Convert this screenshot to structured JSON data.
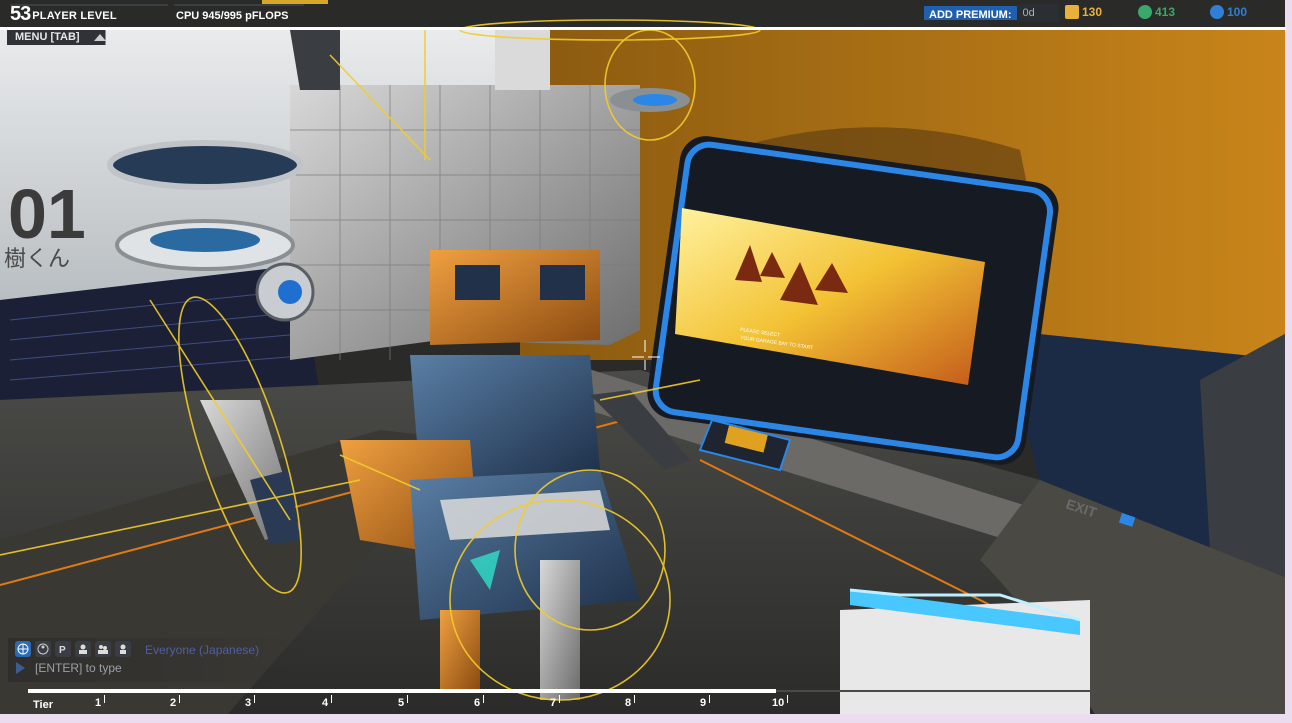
{
  "hud": {
    "player_level": "53",
    "player_level_label": "PLAYER LEVEL",
    "cpu_text": "CPU  945/995 pFLOPS",
    "menu_label": "MENU [TAB]",
    "premium_button": "ADD PREMIUM:",
    "premium_days": "0d",
    "currencies": [
      {
        "icon": "robits-icon",
        "value": "130",
        "color": "#e8b23a"
      },
      {
        "icon": "rp-icon",
        "value": "413",
        "color": "#3aa86a"
      },
      {
        "icon": "gc-icon",
        "value": "100",
        "color": "#2f7fd6"
      }
    ]
  },
  "chat": {
    "icons": [
      "globe-icon",
      "accessibility-icon",
      "party-icon",
      "friends-icon",
      "clan-icon",
      "user-icon"
    ],
    "channel": "Everyone (Japanese)",
    "placeholder": "[ENTER] to type"
  },
  "tiers": {
    "label": "Tier",
    "ticks": [
      "1",
      "2",
      "3",
      "4",
      "5",
      "6",
      "7",
      "8",
      "9",
      "10"
    ],
    "progress": 0.605
  },
  "scene": {
    "wall_text": "01",
    "wall_text_jp": "樹くん",
    "exit_label": "EXIT",
    "screen_caption_1": "PLEASE SELECT",
    "screen_caption_2": "YOUR GARAGE BAY TO START"
  }
}
